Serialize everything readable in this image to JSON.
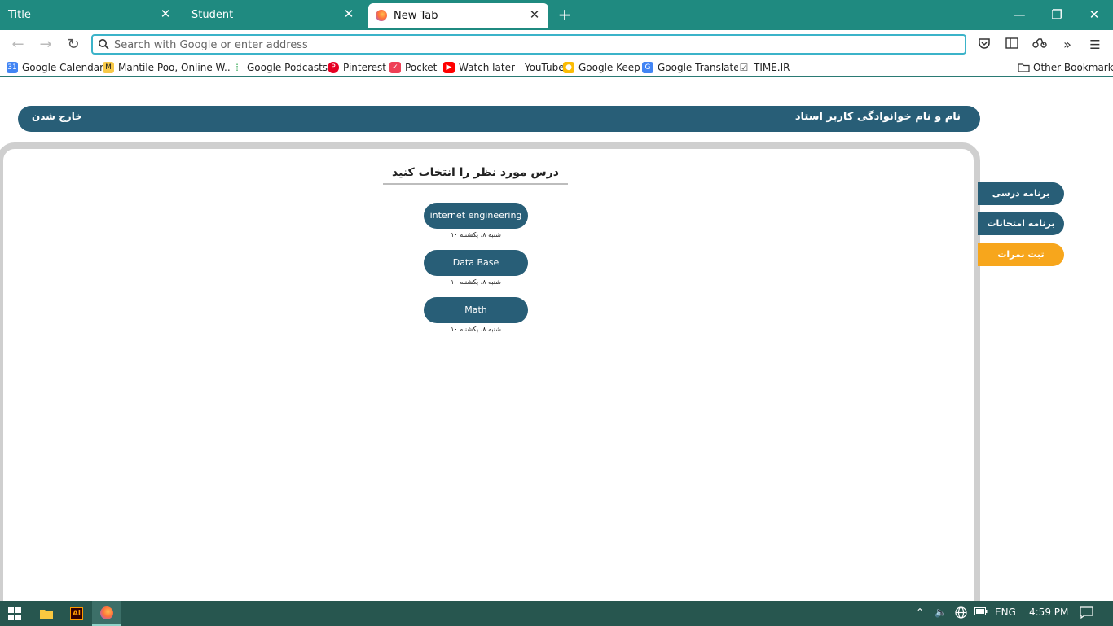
{
  "browser": {
    "tabs": [
      {
        "label": "Title",
        "active": false
      },
      {
        "label": "Student",
        "active": false
      },
      {
        "label": "New Tab",
        "active": true
      }
    ],
    "address_placeholder": "Search with Google or enter address",
    "bookmarks": [
      {
        "label": "Google Calendar",
        "icon": "calendar-icon",
        "color": "#4285f4"
      },
      {
        "label": "Mantile Poo, Online W...",
        "icon": "mantile-icon",
        "color": "#222222"
      },
      {
        "label": "Google Podcasts",
        "icon": "podcasts-icon",
        "color": "#34a853"
      },
      {
        "label": "Pinterest",
        "icon": "pinterest-icon",
        "color": "#e60023"
      },
      {
        "label": "Pocket",
        "icon": "pocket-icon",
        "color": "#ef4056"
      },
      {
        "label": "Watch later - YouTube",
        "icon": "youtube-icon",
        "color": "#ff0000"
      },
      {
        "label": "Google Keep",
        "icon": "keep-icon",
        "color": "#fbbc04"
      },
      {
        "label": "Google Translate",
        "icon": "translate-icon",
        "color": "#4285f4"
      },
      {
        "label": "TIME.IR",
        "icon": "time-icon",
        "color": "#555555"
      }
    ],
    "other_bookmarks": "Other Bookmarks",
    "accent": "#1f8a80"
  },
  "page": {
    "header_title": "نام و نام خوانوادگی کاربر استاد",
    "logout_label": "خارج شدن",
    "heading": "درس مورد نظر را انتخاب کنید",
    "courses": [
      {
        "name": "internet engineering",
        "time": "شنبه ۸، یکشنبه ۱۰"
      },
      {
        "name": "Data Base",
        "time": "شنبه ۸، یکشنبه ۱۰"
      },
      {
        "name": "Math",
        "time": "شنبه ۸، یکشنبه ۱۰"
      }
    ],
    "side_menu": [
      {
        "label": "برنامه درسی",
        "active": false
      },
      {
        "label": "برنامه امتحانات",
        "active": false
      },
      {
        "label": "ثبت نمرات",
        "active": true
      }
    ],
    "colors": {
      "primary": "#285e77",
      "active": "#f7a61c",
      "panel_border": "#cfcfcf"
    }
  },
  "taskbar": {
    "language": "ENG",
    "time": "4:59 PM"
  }
}
